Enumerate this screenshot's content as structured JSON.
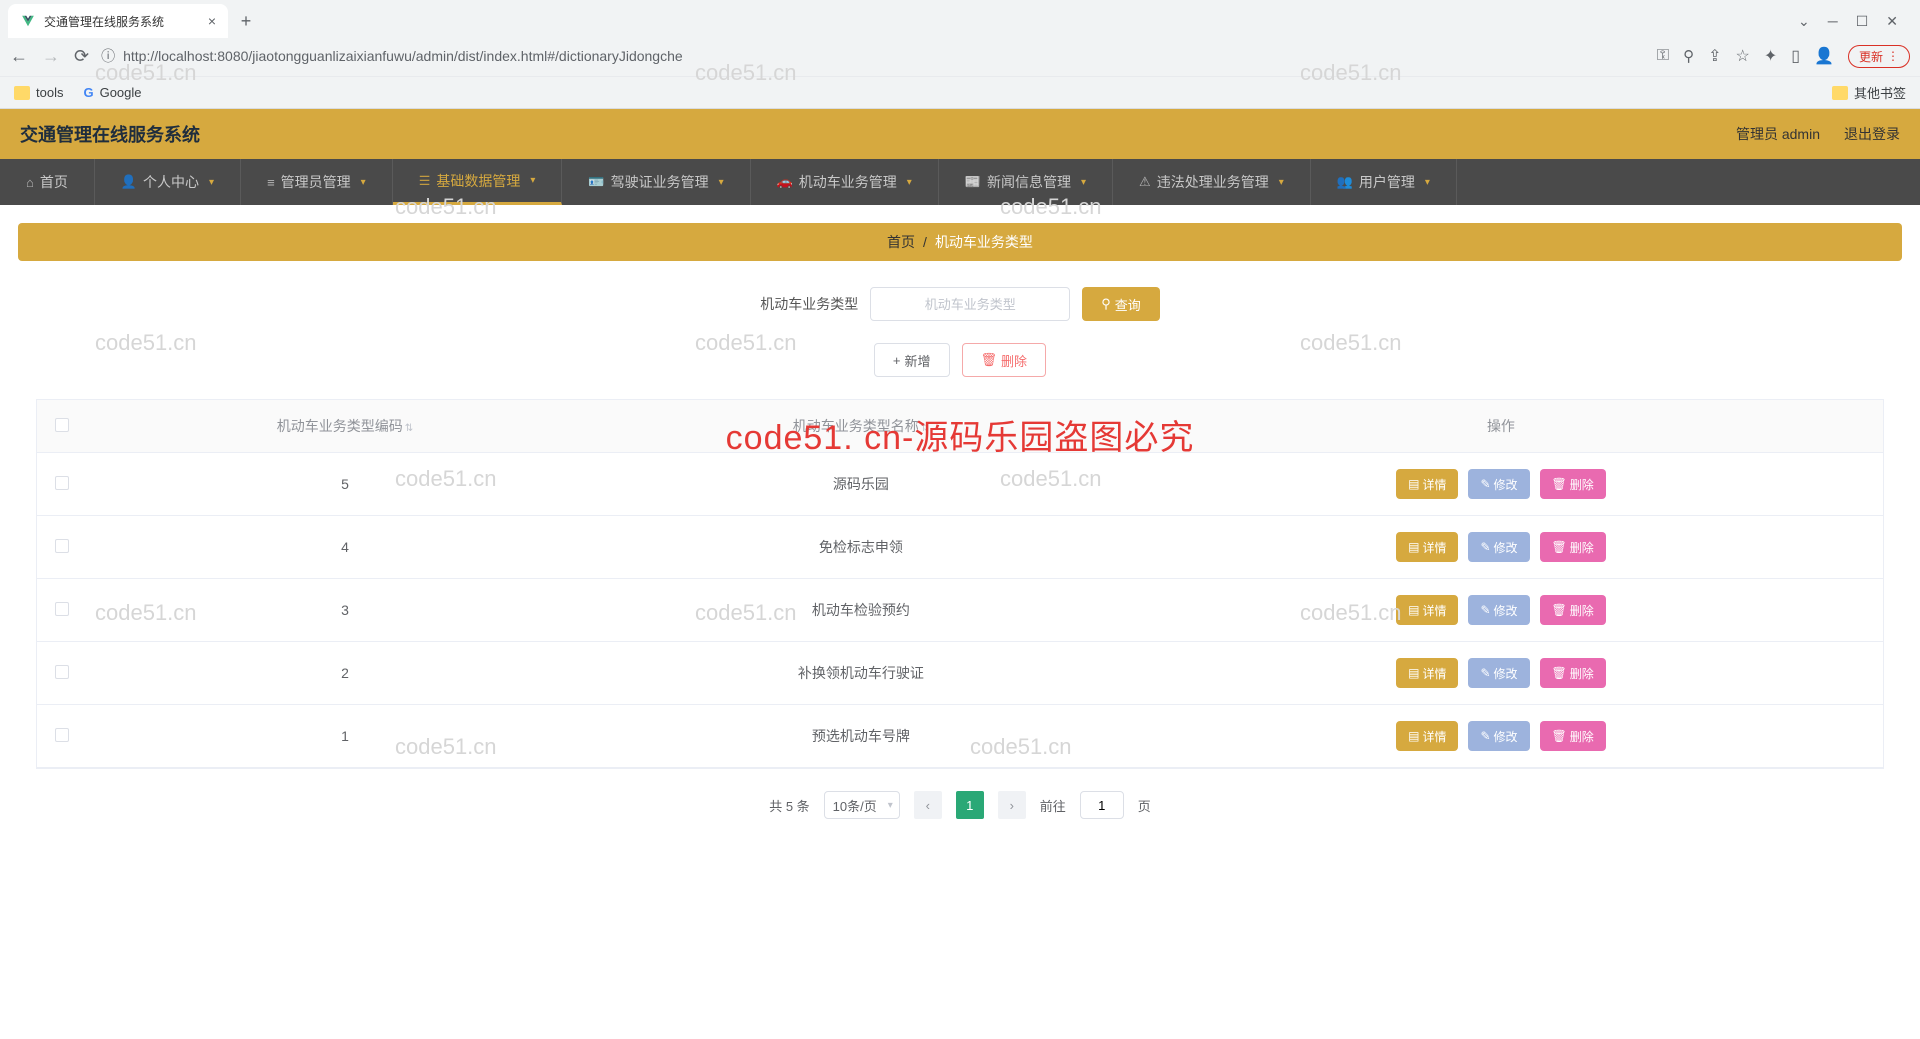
{
  "browser": {
    "tab_title": "交通管理在线服务系统",
    "url": "http://localhost:8080/jiaotongguanlizaixianfuwu/admin/dist/index.html#/dictionaryJidongche",
    "update_label": "更新",
    "bookmarks": {
      "tools": "tools",
      "google": "Google",
      "other": "其他书签"
    }
  },
  "app": {
    "title": "交通管理在线服务系统",
    "user_label": "管理员 admin",
    "logout_label": "退出登录"
  },
  "nav": {
    "items": [
      {
        "label": "首页",
        "caret": false
      },
      {
        "label": "个人中心",
        "caret": true
      },
      {
        "label": "管理员管理",
        "caret": true
      },
      {
        "label": "基础数据管理",
        "caret": true,
        "active": true
      },
      {
        "label": "驾驶证业务管理",
        "caret": true
      },
      {
        "label": "机动车业务管理",
        "caret": true
      },
      {
        "label": "新闻信息管理",
        "caret": true
      },
      {
        "label": "违法处理业务管理",
        "caret": true
      },
      {
        "label": "用户管理",
        "caret": true
      }
    ]
  },
  "breadcrumb": {
    "home": "首页",
    "sep": "/",
    "current": "机动车业务类型"
  },
  "search": {
    "label": "机动车业务类型",
    "placeholder": "机动车业务类型",
    "button": "查询"
  },
  "actions": {
    "add": "新增",
    "delete": "删除"
  },
  "table": {
    "headers": {
      "code": "机动车业务类型编码",
      "name": "机动车业务类型名称",
      "ops": "操作"
    },
    "op_labels": {
      "detail": "详情",
      "edit": "修改",
      "delete": "删除"
    },
    "rows": [
      {
        "code": "5",
        "name": "源码乐园"
      },
      {
        "code": "4",
        "name": "免检标志申领"
      },
      {
        "code": "3",
        "name": "机动车检验预约"
      },
      {
        "code": "2",
        "name": "补换领机动车行驶证"
      },
      {
        "code": "1",
        "name": "预选机动车号牌"
      }
    ]
  },
  "pagination": {
    "total": "共 5 条",
    "page_size": "10条/页",
    "current": "1",
    "goto_prefix": "前往",
    "goto_value": "1",
    "goto_suffix": "页"
  },
  "watermark": "code51. cn-源码乐园盗图必究",
  "ghost_wm": "code51.cn"
}
